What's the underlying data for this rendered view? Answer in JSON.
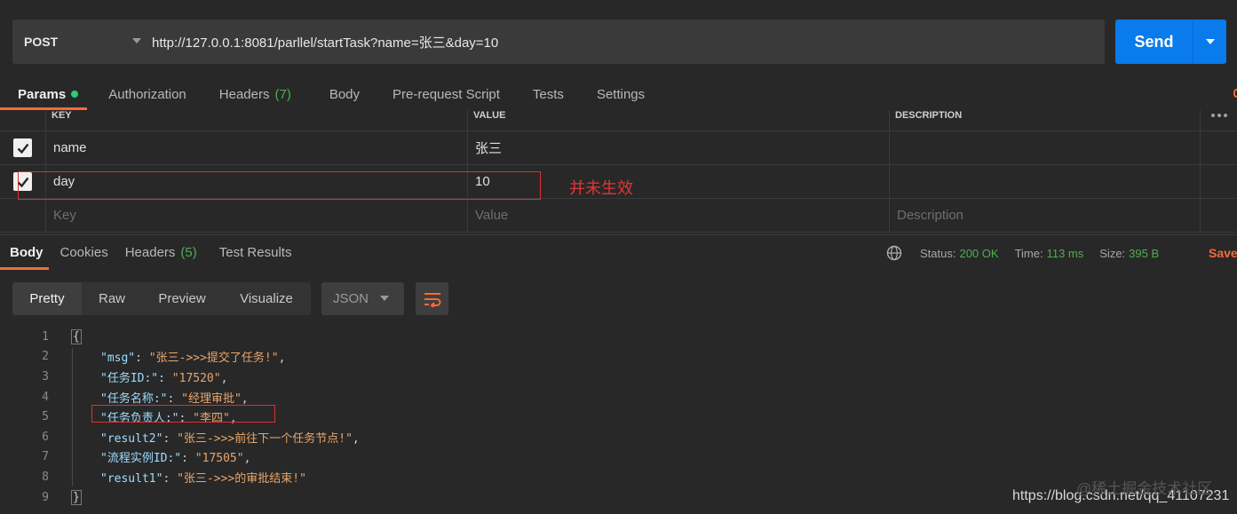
{
  "request": {
    "method": "POST",
    "url": "http://127.0.0.1:8081/parllel/startTask?name=张三&day=10",
    "send_label": "Send"
  },
  "request_tabs": [
    {
      "label": "Params",
      "active": true
    },
    {
      "label": "Authorization"
    },
    {
      "label": "Headers",
      "count": "(7)"
    },
    {
      "label": "Body"
    },
    {
      "label": "Pre-request Script"
    },
    {
      "label": "Tests"
    },
    {
      "label": "Settings"
    }
  ],
  "params_table": {
    "headers": {
      "key": "KEY",
      "value": "VALUE",
      "description": "DESCRIPTION"
    },
    "rows": [
      {
        "checked": true,
        "key": "name",
        "value": "张三",
        "description": ""
      },
      {
        "checked": true,
        "key": "day",
        "value": "10",
        "description": ""
      }
    ],
    "placeholders": {
      "key": "Key",
      "value": "Value",
      "description": "Description"
    }
  },
  "annotation_note": "并未生效",
  "response_tabs": [
    {
      "label": "Body",
      "active": true
    },
    {
      "label": "Cookies"
    },
    {
      "label": "Headers",
      "count": "(5)"
    },
    {
      "label": "Test Results"
    }
  ],
  "response_status": {
    "status_label": "Status:",
    "status_value": "200 OK",
    "time_label": "Time:",
    "time_value": "113 ms",
    "size_label": "Size:",
    "size_value": "395 B",
    "save_label": "Save"
  },
  "view_modes": [
    "Pretty",
    "Raw",
    "Preview",
    "Visualize"
  ],
  "format": "JSON",
  "code_lines": [
    {
      "n": "1",
      "text": "{"
    },
    {
      "n": "2",
      "key": "\"msg\"",
      "value": "\"张三->>>提交了任务!\"",
      "comma": ","
    },
    {
      "n": "3",
      "key": "\"任务ID:\"",
      "value": "\"17520\"",
      "comma": ","
    },
    {
      "n": "4",
      "key": "\"任务名称:\"",
      "value": "\"经理审批\"",
      "comma": ","
    },
    {
      "n": "5",
      "key": "\"任务负责人:\"",
      "value": "\"李四\"",
      "comma": ","
    },
    {
      "n": "6",
      "key": "\"result2\"",
      "value": "\"张三->>>前往下一个任务节点!\"",
      "comma": ","
    },
    {
      "n": "7",
      "key": "\"流程实例ID:\"",
      "value": "\"17505\"",
      "comma": ","
    },
    {
      "n": "8",
      "key": "\"result1\"",
      "value": "\"张三->>>的审批结束!\"",
      "comma": ""
    },
    {
      "n": "9",
      "text": "}"
    }
  ],
  "watermark": {
    "faint": "@稀土掘金技术社区",
    "text": "https://blog.csdn.net/qq_41107231"
  },
  "colors": {
    "accent_orange": "#f26b3a",
    "send_blue": "#097bed",
    "status_green": "#4caf50",
    "annotation_red": "#e03030"
  }
}
